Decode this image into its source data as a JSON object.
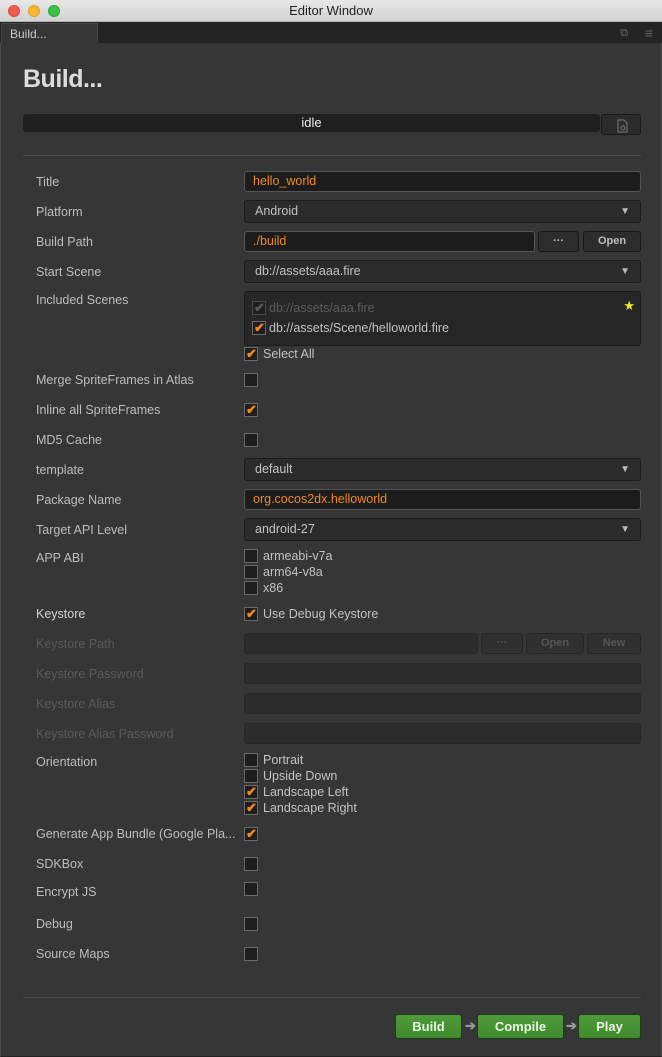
{
  "window": {
    "title": "Editor Window",
    "tab_label": "Build..."
  },
  "header": {
    "title": "Build...",
    "status": "idle"
  },
  "form": {
    "title": {
      "label": "Title",
      "value": "hello_world"
    },
    "platform": {
      "label": "Platform",
      "value": "Android"
    },
    "build_path": {
      "label": "Build Path",
      "value": "./build",
      "browse_label": "···",
      "open_label": "Open"
    },
    "start_scene": {
      "label": "Start Scene",
      "value": "db://assets/aaa.fire"
    },
    "included_scenes": {
      "label": "Included Scenes",
      "items": [
        {
          "path": "db://assets/aaa.fire",
          "checked": true,
          "disabled": true,
          "starred": true
        },
        {
          "path": "db://assets/Scene/helloworld.fire",
          "checked": true,
          "disabled": false,
          "starred": false
        }
      ],
      "select_all_label": "Select All",
      "select_all_checked": true
    },
    "merge_spriteframes": {
      "label": "Merge SpriteFrames in Atlas",
      "checked": false
    },
    "inline_spriteframes": {
      "label": "Inline all SpriteFrames",
      "checked": true
    },
    "md5_cache": {
      "label": "MD5 Cache",
      "checked": false
    },
    "template": {
      "label": "template",
      "value": "default"
    },
    "package_name": {
      "label": "Package Name",
      "value": "org.cocos2dx.helloworld"
    },
    "target_api": {
      "label": "Target API Level",
      "value": "android-27"
    },
    "app_abi": {
      "label": "APP ABI",
      "options": [
        {
          "label": "armeabi-v7a",
          "checked": false
        },
        {
          "label": "arm64-v8a",
          "checked": false
        },
        {
          "label": "x86",
          "checked": false
        }
      ]
    },
    "keystore": {
      "label": "Keystore",
      "option_label": "Use Debug Keystore",
      "checked": true
    },
    "keystore_path": {
      "label": "Keystore Path",
      "value": "",
      "browse_label": "···",
      "open_label": "Open",
      "new_label": "New"
    },
    "keystore_password": {
      "label": "Keystore Password",
      "value": ""
    },
    "keystore_alias": {
      "label": "Keystore Alias",
      "value": ""
    },
    "keystore_alias_password": {
      "label": "Keystore Alias Password",
      "value": ""
    },
    "orientation": {
      "label": "Orientation",
      "options": [
        {
          "label": "Portrait",
          "checked": false
        },
        {
          "label": "Upside Down",
          "checked": false
        },
        {
          "label": "Landscape Left",
          "checked": true
        },
        {
          "label": "Landscape Right",
          "checked": true
        }
      ]
    },
    "app_bundle": {
      "label": "Generate App Bundle (Google Pla...",
      "checked": true
    },
    "sdkbox": {
      "label": "SDKBox",
      "checked": false
    },
    "encrypt_js": {
      "label": "Encrypt JS",
      "checked": false
    },
    "debug": {
      "label": "Debug",
      "checked": false
    },
    "source_maps": {
      "label": "Source Maps",
      "checked": false
    }
  },
  "actions": {
    "build_label": "Build",
    "compile_label": "Compile",
    "play_label": "Play",
    "arrow": "➔"
  },
  "icons": {
    "check": "✔",
    "star": "★",
    "dropdown": "▼",
    "menu": "≡",
    "popout": "⧉"
  },
  "colors": {
    "accent_orange": "#f28a1e",
    "action_green": "#4a9636",
    "panel_bg": "#363636",
    "star_yellow": "#f5e62a"
  }
}
